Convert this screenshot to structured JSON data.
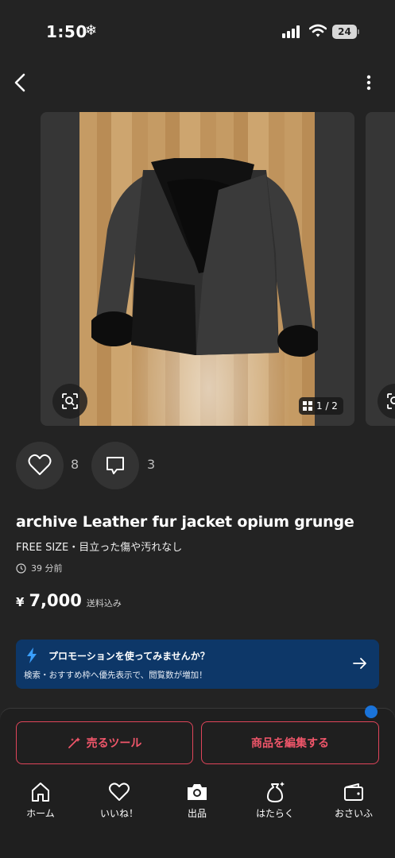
{
  "status": {
    "time": "1:50",
    "battery": "24"
  },
  "gallery": {
    "counter": "1 / 2"
  },
  "engagement": {
    "likes": "8",
    "comments": "3"
  },
  "item": {
    "title": "archive Leather fur jacket opium grunge",
    "subtitle": "FREE SIZE・目立った傷や汚れなし",
    "posted": "39 分前",
    "price_symbol": "¥",
    "price": "7,000",
    "shipping_note": "送料込み"
  },
  "promo": {
    "title": "プロモーションを使ってみませんか？",
    "body": "検索・おすすめ枠へ優先表示で、閲覧数が増加！",
    "accent": "#0d3768"
  },
  "actions": {
    "sell_tools": "売るツール",
    "edit_item": "商品を編集する",
    "accent": "#e0455a"
  },
  "nav": [
    {
      "label": "ホーム",
      "icon": "home-icon"
    },
    {
      "label": "いいね！",
      "icon": "heart-icon"
    },
    {
      "label": "出品",
      "icon": "camera-icon"
    },
    {
      "label": "はたらく",
      "icon": "bag-sparkle-icon"
    },
    {
      "label": "おさいふ",
      "icon": "wallet-icon"
    }
  ]
}
